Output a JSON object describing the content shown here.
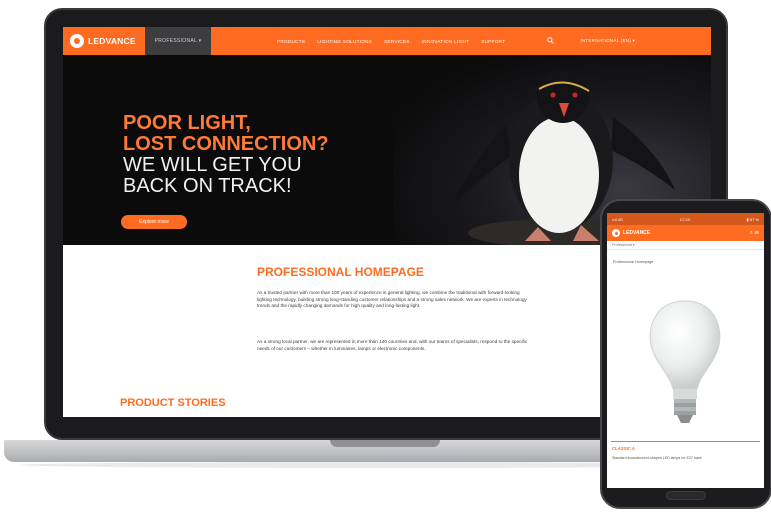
{
  "brand": {
    "name": "LEDVANCE",
    "accent": "#ff6b21",
    "dark": "#0b0b0c"
  },
  "laptop": {
    "nav": {
      "dropdown": "PROFESSIONAL ▾",
      "links": [
        "PRODUCTS",
        "LIGHTING SOLUTIONS",
        "SERVICES",
        "INNOVATION LIGHT",
        "SUPPORT"
      ],
      "search_icon": "search-icon",
      "language": "INTERNATIONAL (EN) ▾"
    },
    "hero": {
      "line1": "POOR LIGHT,",
      "line2": "LOST CONNECTION?",
      "line3": "WE WILL GET YOU",
      "line4": "BACK ON TRACK!",
      "cta": "Explore more"
    },
    "content": {
      "title": "PROFESSIONAL HOMEPAGE",
      "paragraph1": "As a trusted partner with more than 100 years of experience in general lighting, we combine the traditional with forward-looking lighting technology, building strong long-standing customer relationships and a strong sales network. We are experts in technology trends and the rapidly changing demands for high quality and long-lasting light.",
      "paragraph2": "As a strong local partner, we are represented in more than 140 countries and, with our teams of specialists, respond to the specific needs of our customers – whether in luminaires, lamps or electronic components.",
      "section2_title": "PRODUCT STORIES"
    }
  },
  "phone": {
    "status_left": "••ll 4G",
    "status_time": "17:23",
    "status_right": "▮ 87 %",
    "nav_title": "LEDVANCE",
    "nav_icons": "⌕  ☰",
    "dropdown": "Professional ▾",
    "breadcrumb": "Professional Homepage",
    "product_name": "CLASSIC A",
    "product_desc": "Standard incandescent-shaped LED lamps for E27 base"
  }
}
